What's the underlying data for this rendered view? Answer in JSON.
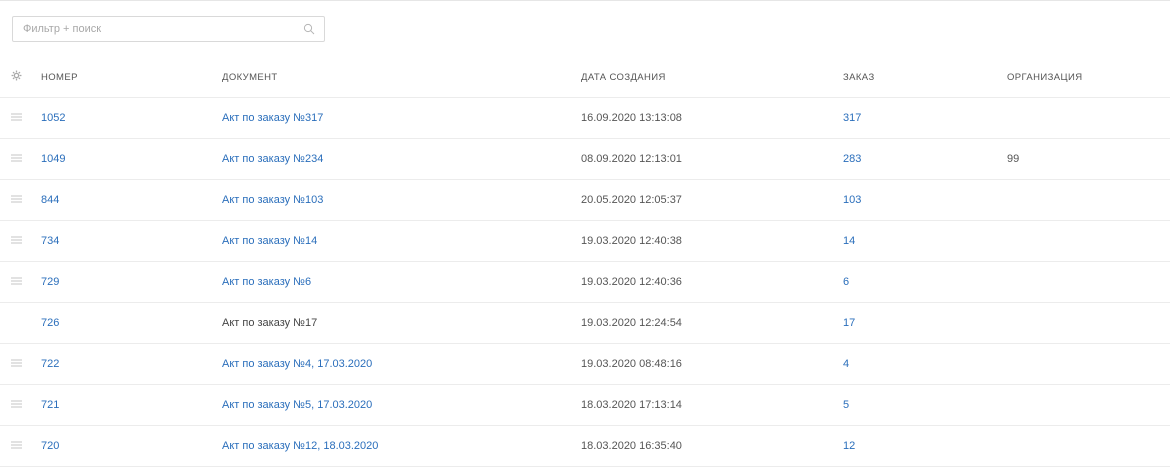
{
  "search": {
    "placeholder": "Фильтр + поиск",
    "icon": "search-icon"
  },
  "table": {
    "columns": {
      "settings_icon": "gear-icon",
      "number": "НОМЕР",
      "document": "ДОКУМЕНТ",
      "created": "ДАТА СОЗДАНИЯ",
      "order": "ЗАКАЗ",
      "organization": "ОРГАНИЗАЦИЯ"
    },
    "rows": [
      {
        "number": "1052",
        "document": "Акт по заказу №317",
        "created": "16.09.2020 13:13:08",
        "order": "317",
        "organization": "",
        "handle": true,
        "doc_link": true
      },
      {
        "number": "1049",
        "document": "Акт по заказу №234",
        "created": "08.09.2020 12:13:01",
        "order": "283",
        "organization": "99",
        "handle": true,
        "doc_link": true
      },
      {
        "number": "844",
        "document": "Акт по заказу №103",
        "created": "20.05.2020 12:05:37",
        "order": "103",
        "organization": "",
        "handle": true,
        "doc_link": true
      },
      {
        "number": "734",
        "document": "Акт по заказу №14",
        "created": "19.03.2020 12:40:38",
        "order": "14",
        "organization": "",
        "handle": true,
        "doc_link": true
      },
      {
        "number": "729",
        "document": "Акт по заказу №6",
        "created": "19.03.2020 12:40:36",
        "order": "6",
        "organization": "",
        "handle": true,
        "doc_link": true
      },
      {
        "number": "726",
        "document": "Акт по заказу №17",
        "created": "19.03.2020 12:24:54",
        "order": "17",
        "organization": "",
        "handle": false,
        "doc_link": false
      },
      {
        "number": "722",
        "document": "Акт по заказу №4, 17.03.2020",
        "created": "19.03.2020 08:48:16",
        "order": "4",
        "organization": "",
        "handle": true,
        "doc_link": true
      },
      {
        "number": "721",
        "document": "Акт по заказу №5, 17.03.2020",
        "created": "18.03.2020 17:13:14",
        "order": "5",
        "organization": "",
        "handle": true,
        "doc_link": true
      },
      {
        "number": "720",
        "document": "Акт по заказу №12, 18.03.2020",
        "created": "18.03.2020 16:35:40",
        "order": "12",
        "organization": "",
        "handle": true,
        "doc_link": true
      }
    ]
  },
  "colors": {
    "link": "#2a6ebb",
    "border": "#ececec",
    "icon": "#b5b5b5"
  }
}
